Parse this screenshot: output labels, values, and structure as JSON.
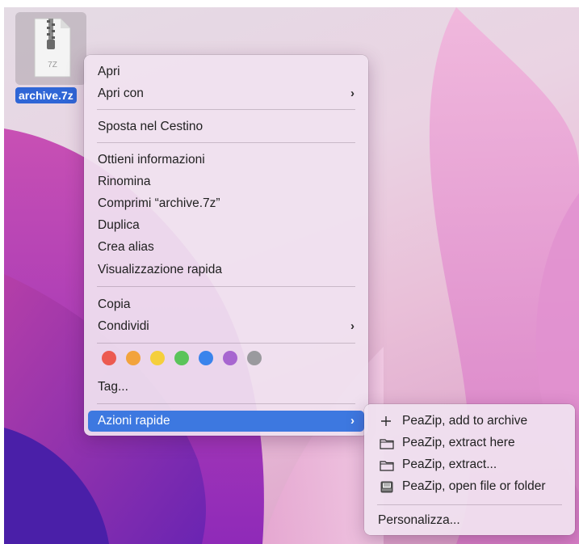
{
  "file": {
    "name": "archive.7z",
    "icon_text": "7Z",
    "icon": "zip-archive-icon"
  },
  "menu": {
    "groups": [
      {
        "items": [
          {
            "label": "Apri",
            "submenu": false
          },
          {
            "label": "Apri con",
            "submenu": true
          }
        ]
      },
      {
        "items": [
          {
            "label": "Sposta nel Cestino",
            "submenu": false
          }
        ]
      },
      {
        "items": [
          {
            "label": "Ottieni informazioni",
            "submenu": false
          },
          {
            "label": "Rinomina",
            "submenu": false
          },
          {
            "label": "Comprimi “archive.7z”",
            "submenu": false
          },
          {
            "label": "Duplica",
            "submenu": false
          },
          {
            "label": "Crea alias",
            "submenu": false
          },
          {
            "label": "Visualizzazione rapida",
            "submenu": false
          }
        ]
      },
      {
        "items": [
          {
            "label": "Copia",
            "submenu": false
          },
          {
            "label": "Condividi",
            "submenu": true
          }
        ]
      }
    ],
    "tag_colors": [
      {
        "name": "red",
        "hex": "#ec5a50"
      },
      {
        "name": "orange",
        "hex": "#f2a33c"
      },
      {
        "name": "yellow",
        "hex": "#f5cf3c"
      },
      {
        "name": "green",
        "hex": "#5ac45a"
      },
      {
        "name": "blue",
        "hex": "#3a84ec"
      },
      {
        "name": "purple",
        "hex": "#a766d0"
      },
      {
        "name": "gray",
        "hex": "#9a9a9e"
      }
    ],
    "tags_label": "Tag...",
    "quick_actions": {
      "label": "Azioni rapide",
      "submenu": true,
      "highlighted": true
    }
  },
  "submenu": {
    "items": [
      {
        "label": "PeaZip, add to archive",
        "icon": "plus-icon"
      },
      {
        "label": "PeaZip, extract here",
        "icon": "folder-icon"
      },
      {
        "label": "PeaZip, extract...",
        "icon": "folder-icon"
      },
      {
        "label": "PeaZip, open file or folder",
        "icon": "tray-icon"
      }
    ],
    "customize_label": "Personalizza..."
  },
  "colors": {
    "highlight": "#3d78e0",
    "selection_label": "#2f66d6"
  }
}
